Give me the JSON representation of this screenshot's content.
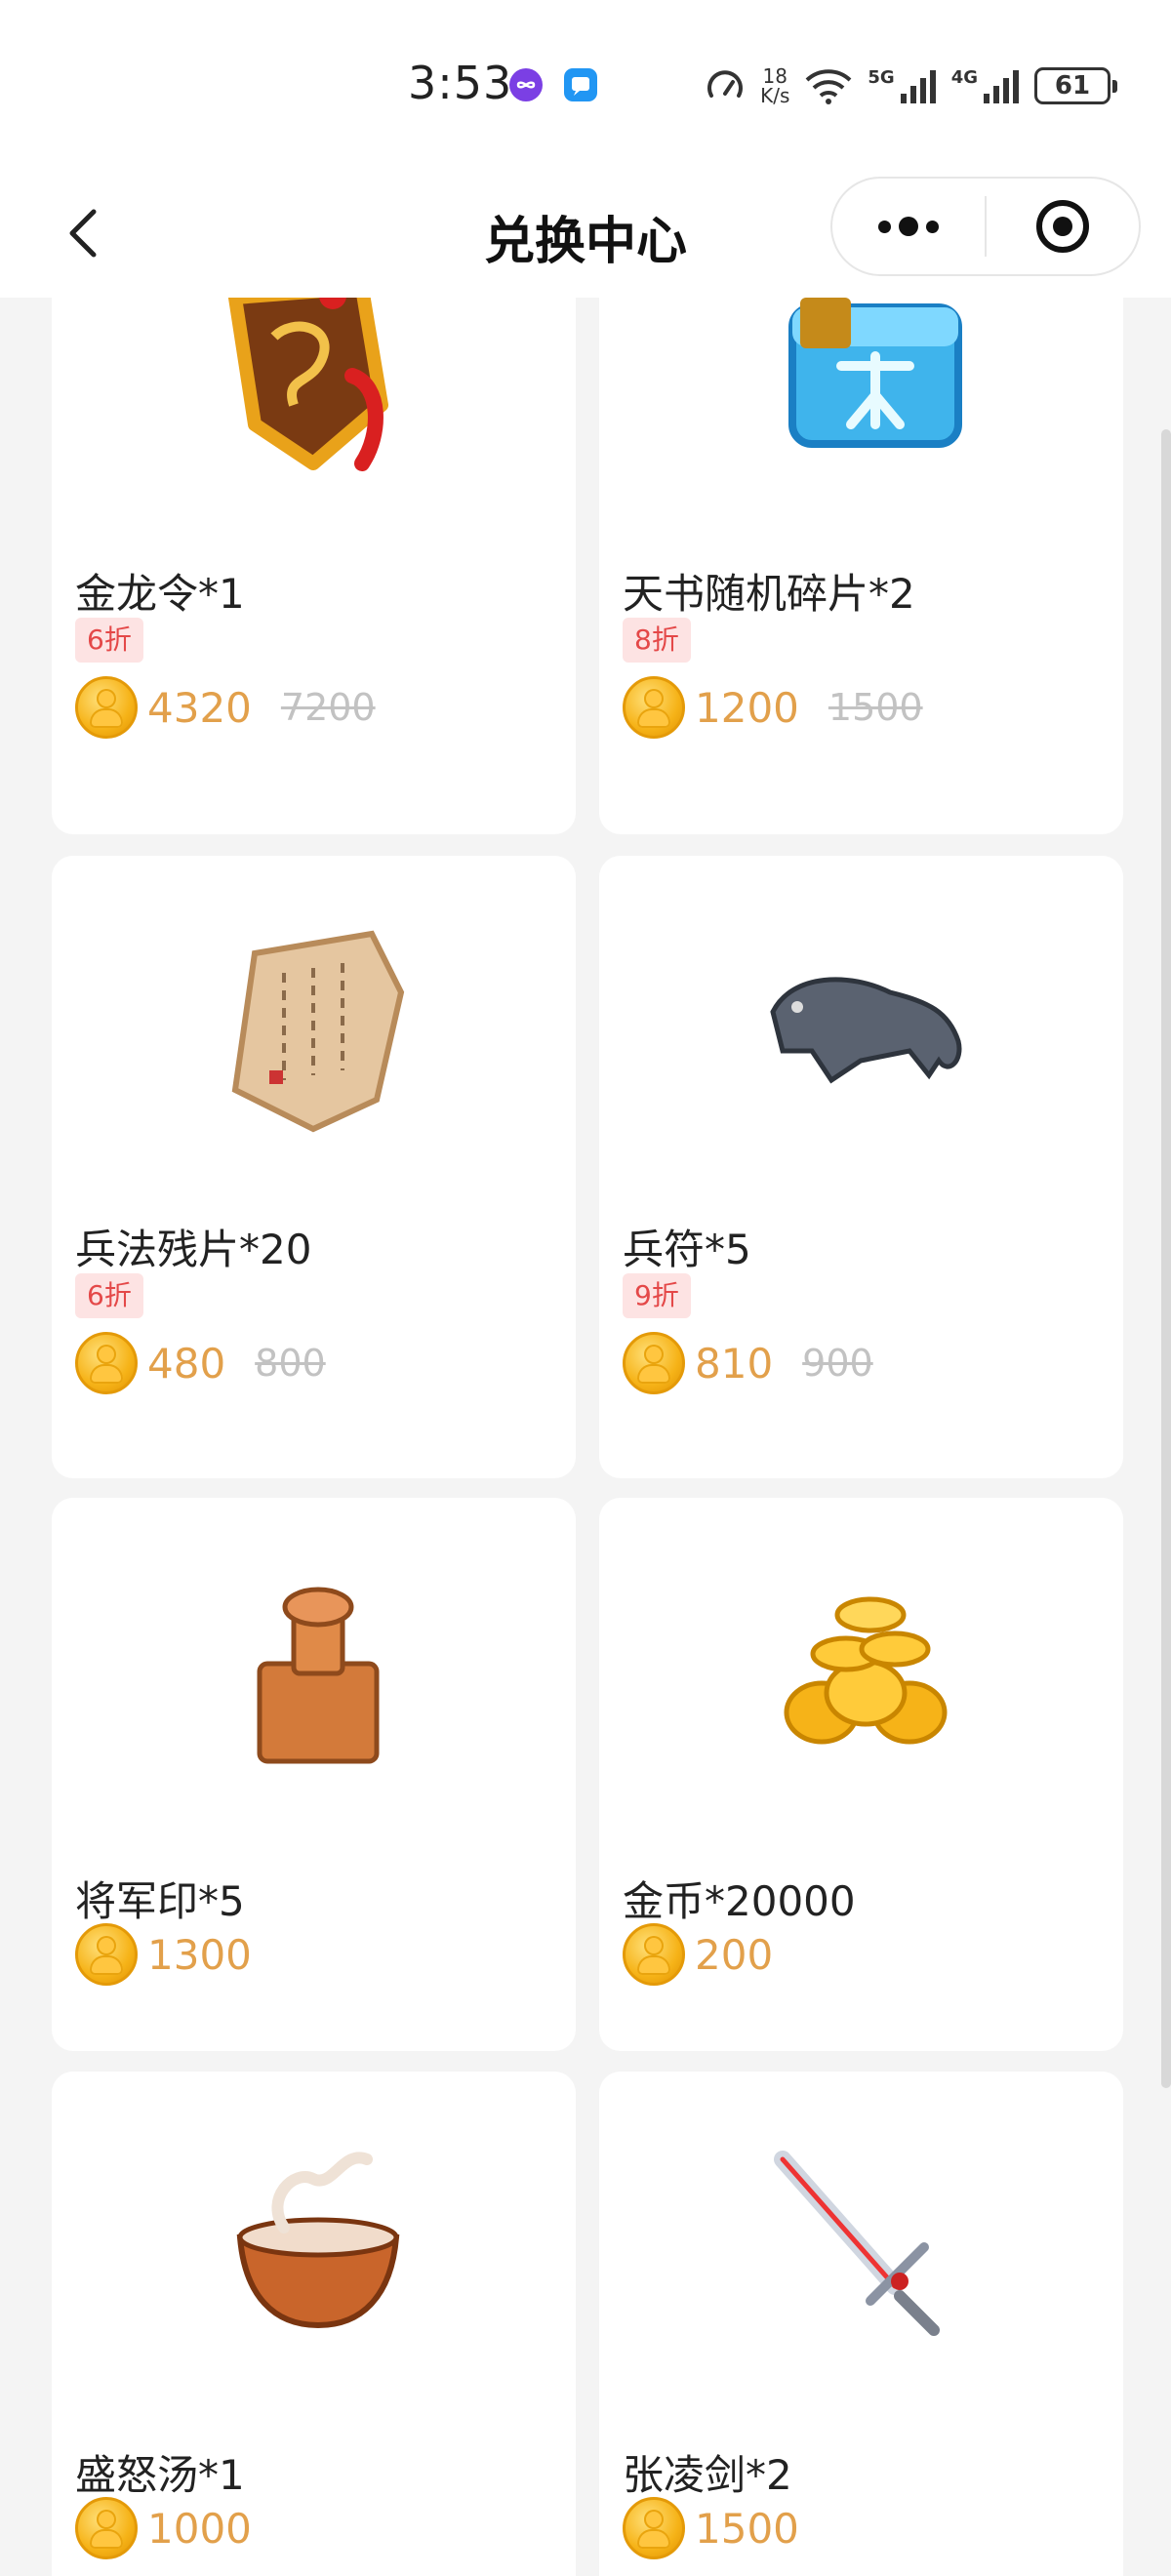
{
  "status_bar": {
    "time": "3:53",
    "net_speed_value": "18",
    "net_speed_unit": "K/s",
    "signal_1": "5G",
    "signal_2": "4G",
    "battery": "61",
    "app_dot_colors": [
      "#7b3fe4",
      "#2196f3"
    ]
  },
  "nav": {
    "title": "兑换中心"
  },
  "items": [
    {
      "name": "金龙令*1",
      "discount": "6折",
      "price": "4320",
      "original_price": "7200",
      "icon": "golden-dragon-token-icon"
    },
    {
      "name": "天书随机碎片*2",
      "discount": "8折",
      "price": "1200",
      "original_price": "1500",
      "icon": "tianshu-fragment-chest-icon"
    },
    {
      "name": "兵法残片*20",
      "discount": "6折",
      "price": "480",
      "original_price": "800",
      "icon": "war-scroll-fragment-icon"
    },
    {
      "name": "兵符*5",
      "discount": "9折",
      "price": "810",
      "original_price": "900",
      "icon": "tiger-tally-icon"
    },
    {
      "name": "将军印*5",
      "discount": "",
      "price": "1300",
      "original_price": "",
      "icon": "general-seal-icon"
    },
    {
      "name": "金币*20000",
      "discount": "",
      "price": "200",
      "original_price": "",
      "icon": "gold-coin-pile-icon"
    },
    {
      "name": "盛怒汤*1",
      "discount": "",
      "price": "1000",
      "original_price": "",
      "icon": "rage-soup-bowl-icon"
    },
    {
      "name": "张凌剑*2",
      "discount": "",
      "price": "1500",
      "original_price": "",
      "icon": "zhangling-sword-icon"
    }
  ],
  "colors": {
    "price": "#e2a04b",
    "discount_tag_bg": "#fde3e3",
    "discount_tag_text": "#e44848",
    "original_price": "#c2c2c2",
    "page_bg": "#f4f4f4"
  }
}
